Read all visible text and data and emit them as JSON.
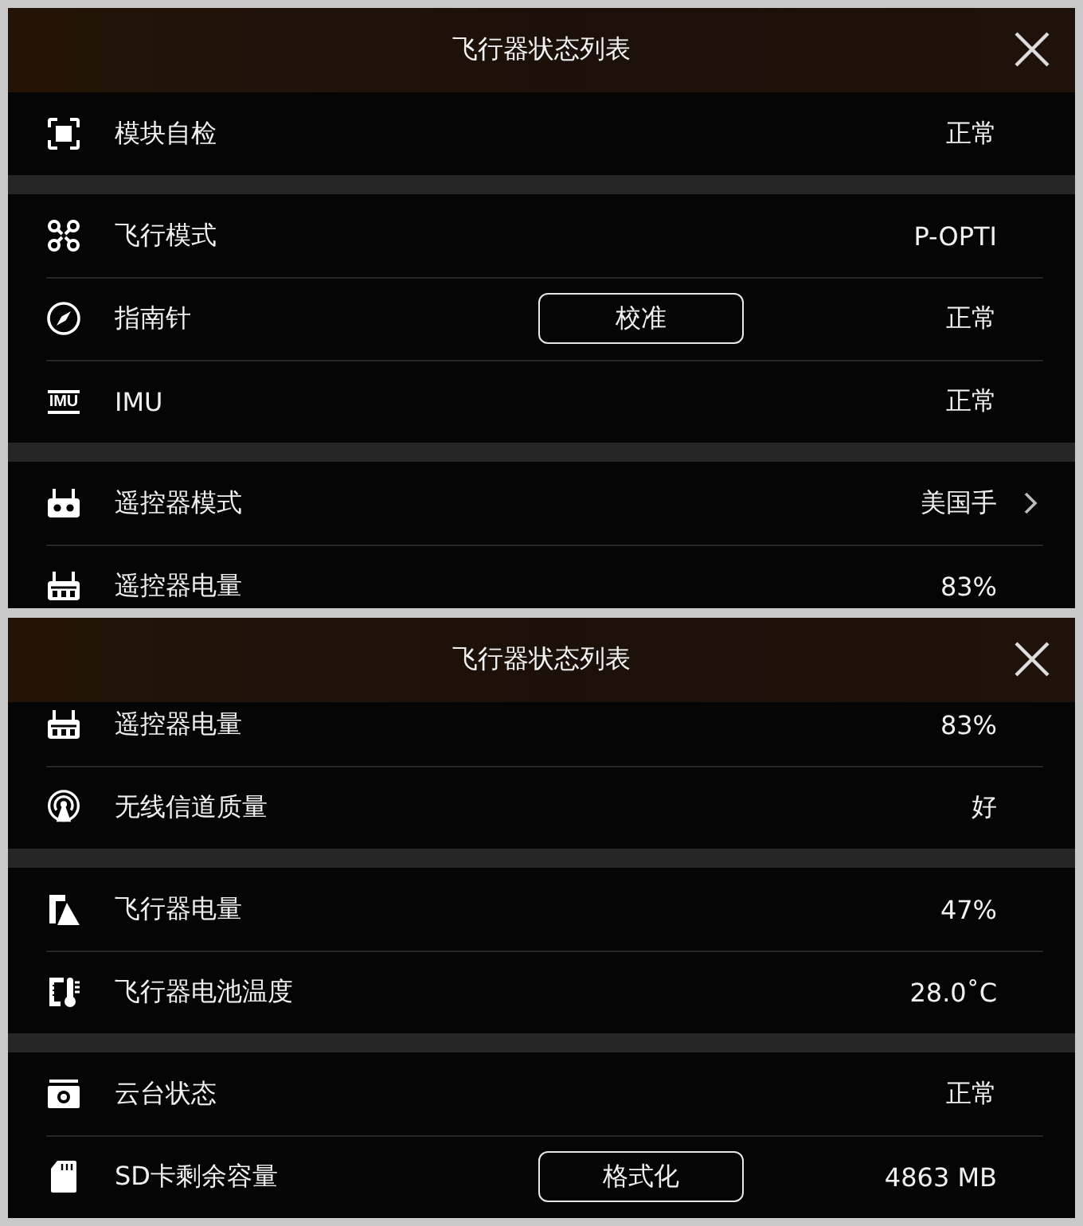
{
  "panels": [
    {
      "title": "飞行器状态列表",
      "sections": [
        {
          "rows": [
            {
              "kind": "module",
              "label": "模块自检",
              "value": "正常"
            }
          ]
        },
        {
          "rows": [
            {
              "kind": "drone",
              "label": "飞行模式",
              "value": "P-OPTI"
            },
            {
              "kind": "compass",
              "label": "指南针",
              "value": "正常",
              "button": "校准"
            },
            {
              "kind": "imu",
              "icon_text": "IMU",
              "label": "IMU",
              "value": "正常"
            }
          ]
        },
        {
          "rows": [
            {
              "kind": "remote",
              "label": "遥控器模式",
              "value": "美国手",
              "submenu": true
            },
            {
              "kind": "remote-battery",
              "label": "遥控器电量",
              "value": "83%"
            }
          ]
        }
      ]
    },
    {
      "title": "飞行器状态列表",
      "sections": [
        {
          "rows": [
            {
              "kind": "remote-battery",
              "label": "遥控器电量",
              "value": "83%"
            },
            {
              "kind": "signal",
              "label": "无线信道质量",
              "value": "好"
            }
          ]
        },
        {
          "rows": [
            {
              "kind": "battery",
              "label": "飞行器电量",
              "value": "47%"
            },
            {
              "kind": "temperature",
              "label": "飞行器电池温度",
              "value": "28.0˚C"
            }
          ]
        },
        {
          "rows": [
            {
              "kind": "gimbal",
              "label": "云台状态",
              "value": "正常"
            },
            {
              "kind": "sdcard",
              "label": "SD卡剩余容量",
              "value": "4863 MB",
              "button": "格式化"
            }
          ]
        }
      ]
    }
  ]
}
